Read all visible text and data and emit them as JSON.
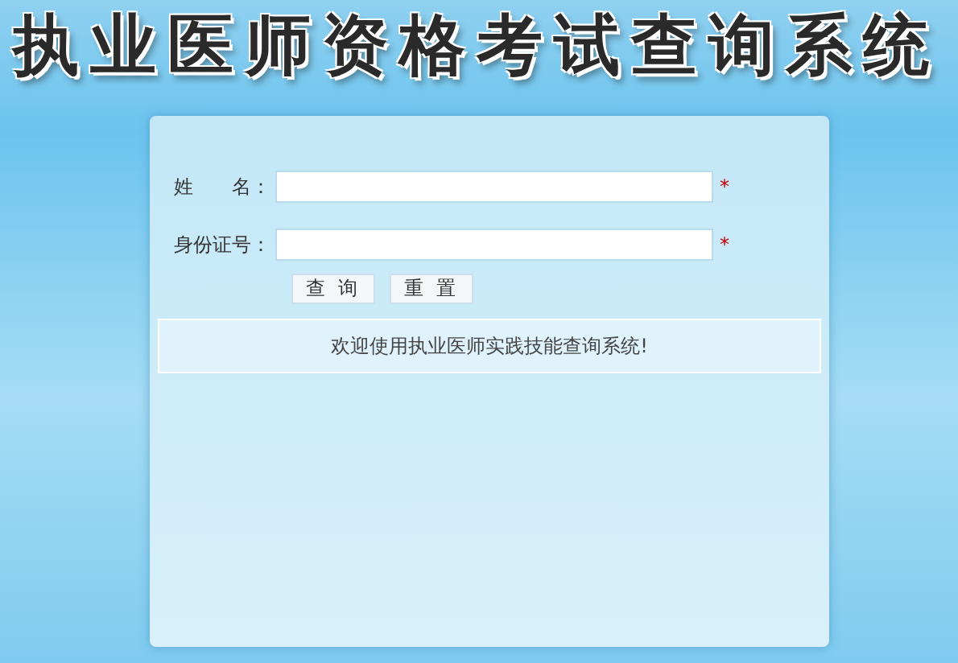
{
  "header": {
    "title": "执业医师资格考试查询系统"
  },
  "form": {
    "fields": [
      {
        "label": "姓　　名：",
        "required_mark": "*"
      },
      {
        "label": "身份证号：",
        "required_mark": "*"
      }
    ],
    "buttons": [
      {
        "label": "查 询"
      },
      {
        "label": "重 置"
      }
    ],
    "message": "欢迎使用执业医师实践技能查询系统!"
  }
}
